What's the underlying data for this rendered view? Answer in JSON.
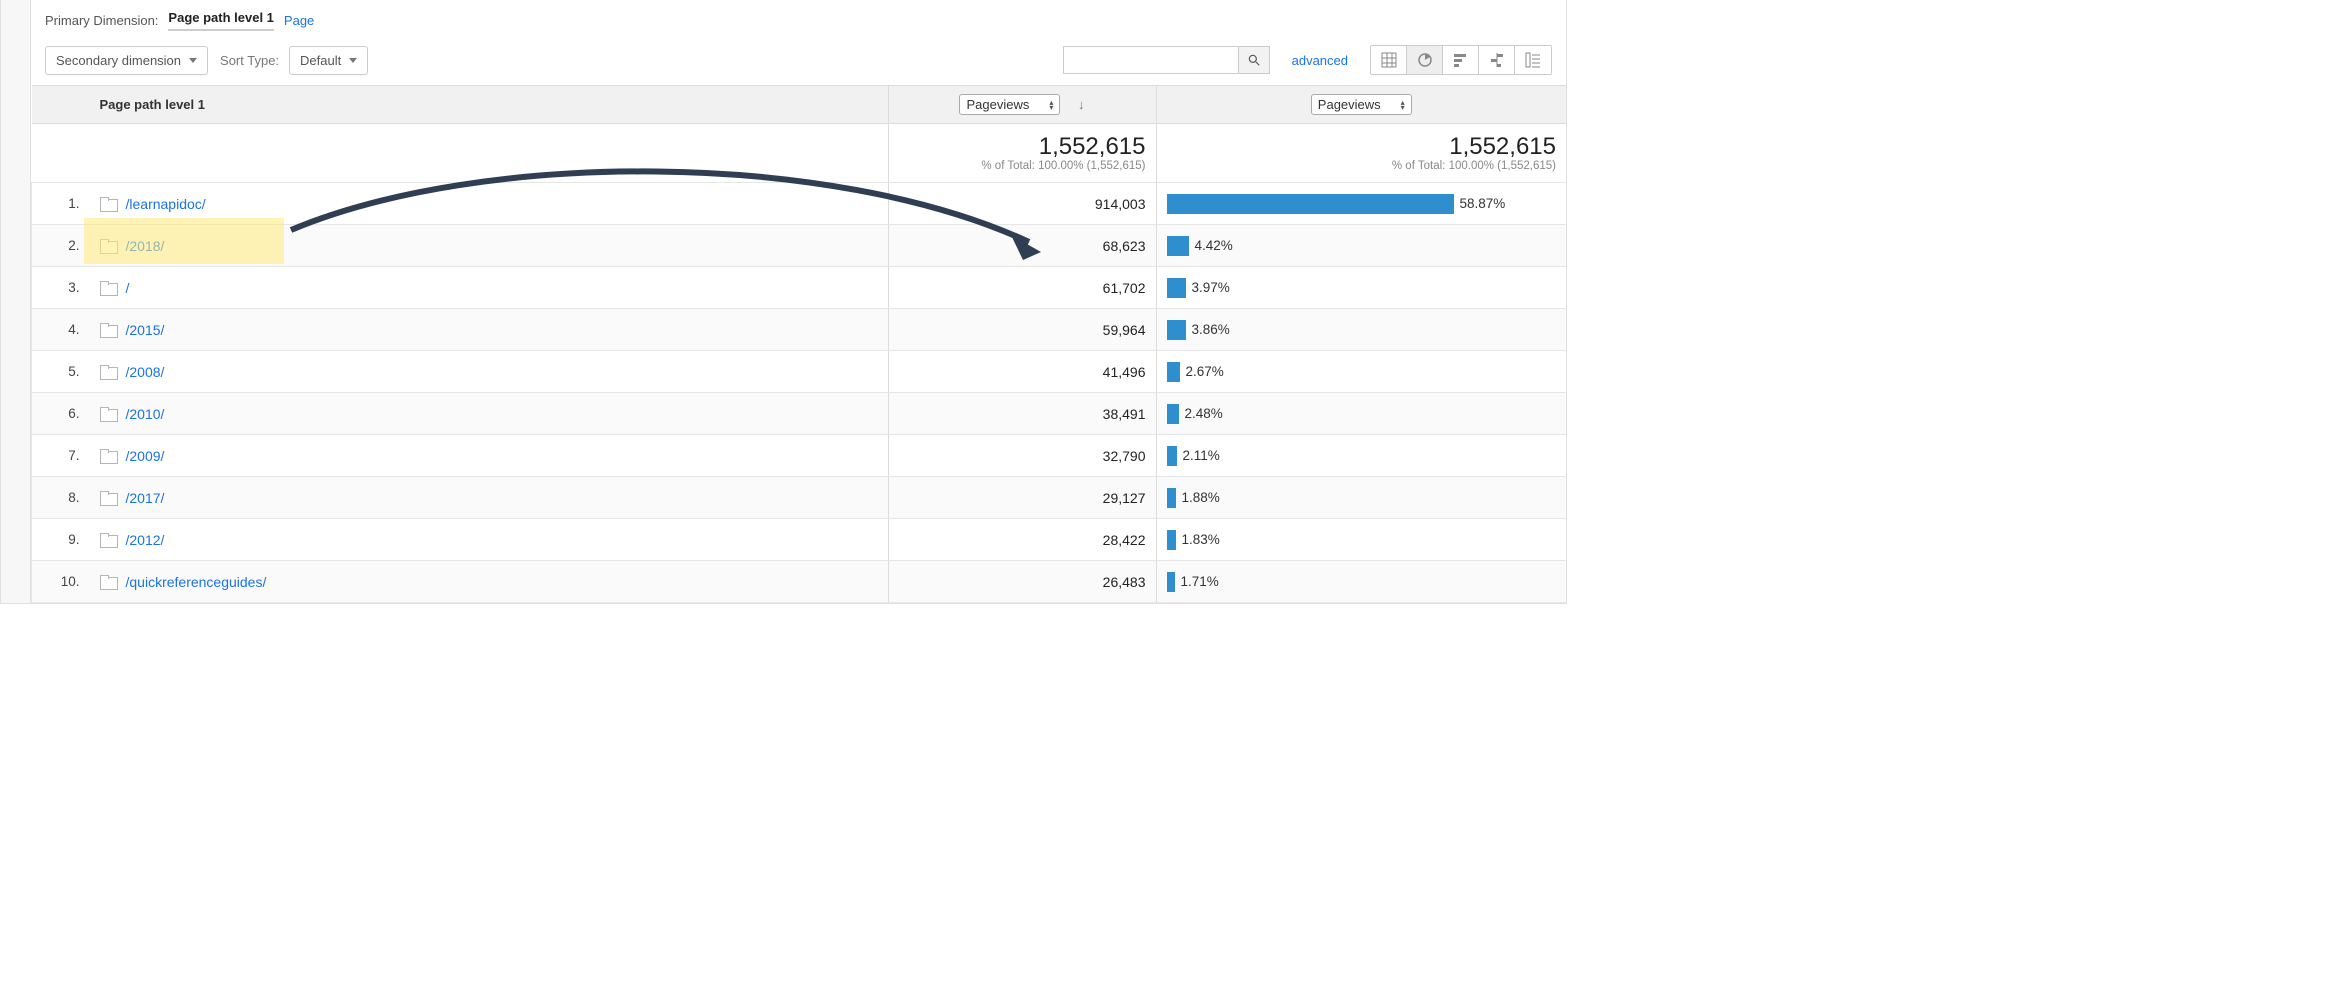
{
  "primary_dimension": {
    "label": "Primary Dimension:",
    "active": "Page path level 1",
    "other": "Page"
  },
  "toolbar": {
    "secondary_dimension": "Secondary dimension",
    "sort_type_label": "Sort Type:",
    "sort_type_value": "Default",
    "advanced": "advanced"
  },
  "columns": {
    "path_header": "Page path level 1",
    "metric1": "Pageviews",
    "metric2": "Pageviews"
  },
  "totals": {
    "value": "1,552,615",
    "subtext": "% of Total: 100.00% (1,552,615)"
  },
  "rows": [
    {
      "n": "1.",
      "path": "/learnapidoc/",
      "pv": "914,003",
      "pct": "58.87%",
      "w": 58.87
    },
    {
      "n": "2.",
      "path": "/2018/",
      "pv": "68,623",
      "pct": "4.42%",
      "w": 4.42
    },
    {
      "n": "3.",
      "path": "/",
      "pv": "61,702",
      "pct": "3.97%",
      "w": 3.97
    },
    {
      "n": "4.",
      "path": "/2015/",
      "pv": "59,964",
      "pct": "3.86%",
      "w": 3.86
    },
    {
      "n": "5.",
      "path": "/2008/",
      "pv": "41,496",
      "pct": "2.67%",
      "w": 2.67
    },
    {
      "n": "6.",
      "path": "/2010/",
      "pv": "38,491",
      "pct": "2.48%",
      "w": 2.48
    },
    {
      "n": "7.",
      "path": "/2009/",
      "pv": "32,790",
      "pct": "2.11%",
      "w": 2.11
    },
    {
      "n": "8.",
      "path": "/2017/",
      "pv": "29,127",
      "pct": "1.88%",
      "w": 1.88
    },
    {
      "n": "9.",
      "path": "/2012/",
      "pv": "28,422",
      "pct": "1.83%",
      "w": 1.83
    },
    {
      "n": "10.",
      "path": "/quickreferenceguides/",
      "pv": "26,483",
      "pct": "1.71%",
      "w": 1.71
    }
  ],
  "chart_data": {
    "type": "bar",
    "title": "Pageviews by Page path level 1",
    "xlabel": "Pageviews",
    "ylabel": "Page path level 1",
    "categories": [
      "/learnapidoc/",
      "/2018/",
      "/",
      "/2015/",
      "/2008/",
      "/2010/",
      "/2009/",
      "/2017/",
      "/2012/",
      "/quickreferenceguides/"
    ],
    "values": [
      914003,
      68623,
      61702,
      59964,
      41496,
      38491,
      32790,
      29127,
      28422,
      26483
    ],
    "percentages": [
      58.87,
      4.42,
      3.97,
      3.86,
      2.67,
      2.48,
      2.11,
      1.88,
      1.83,
      1.71
    ],
    "total": 1552615
  }
}
